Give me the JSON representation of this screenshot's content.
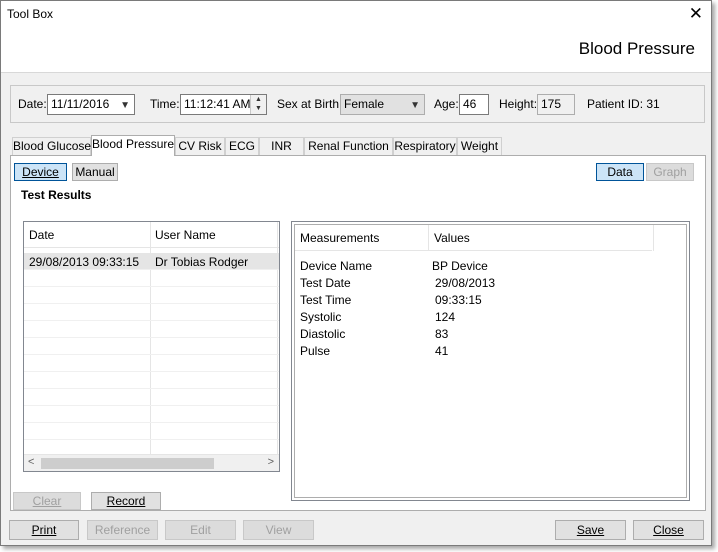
{
  "window": {
    "title": "Tool Box",
    "close_glyph": "✕",
    "page_title": "Blood Pressure"
  },
  "patient": {
    "date_label": "Date:",
    "date_value": "11/11/2016",
    "time_label": "Time:",
    "time_value": "11:12:41 AM",
    "sex_label": "Sex at Birth:",
    "sex_value": "Female",
    "age_label": "Age:",
    "age_value": "46",
    "height_label": "Height:",
    "height_value": "175",
    "patient_id": "Patient ID: 31"
  },
  "tabs": [
    {
      "label": "Blood Glucose"
    },
    {
      "label": "Blood Pressure",
      "active": true
    },
    {
      "label": "CV Risk"
    },
    {
      "label": "ECG"
    },
    {
      "label": "INR"
    },
    {
      "label": "Renal Function"
    },
    {
      "label": "Respiratory"
    },
    {
      "label": "Weight"
    }
  ],
  "mode": {
    "device_label": "Device",
    "manual_label": "Manual",
    "data_label": "Data",
    "graph_label": "Graph"
  },
  "section_title": "Test Results",
  "results": {
    "columns": [
      "Date",
      "User Name"
    ],
    "rows": [
      {
        "date": "29/08/2013 09:33:15",
        "user": "Dr Tobias Rodger"
      }
    ]
  },
  "measurements": {
    "columns": [
      "Measurements",
      "Values"
    ],
    "rows": [
      {
        "name": "Device Name",
        "value": "BP Device"
      },
      {
        "name": "Test Date",
        "value": "29/08/2013"
      },
      {
        "name": "Test Time",
        "value": "09:33:15"
      },
      {
        "name": "Systolic",
        "value": "124"
      },
      {
        "name": "Diastolic",
        "value": "83"
      },
      {
        "name": "Pulse",
        "value": "41"
      }
    ]
  },
  "actions": {
    "clear_label": "Clear",
    "record_label": "Record",
    "print_label": "Print",
    "reference_label": "Reference",
    "edit_label": "Edit",
    "view_label": "View",
    "save_label": "Save",
    "close_label": "Close"
  }
}
